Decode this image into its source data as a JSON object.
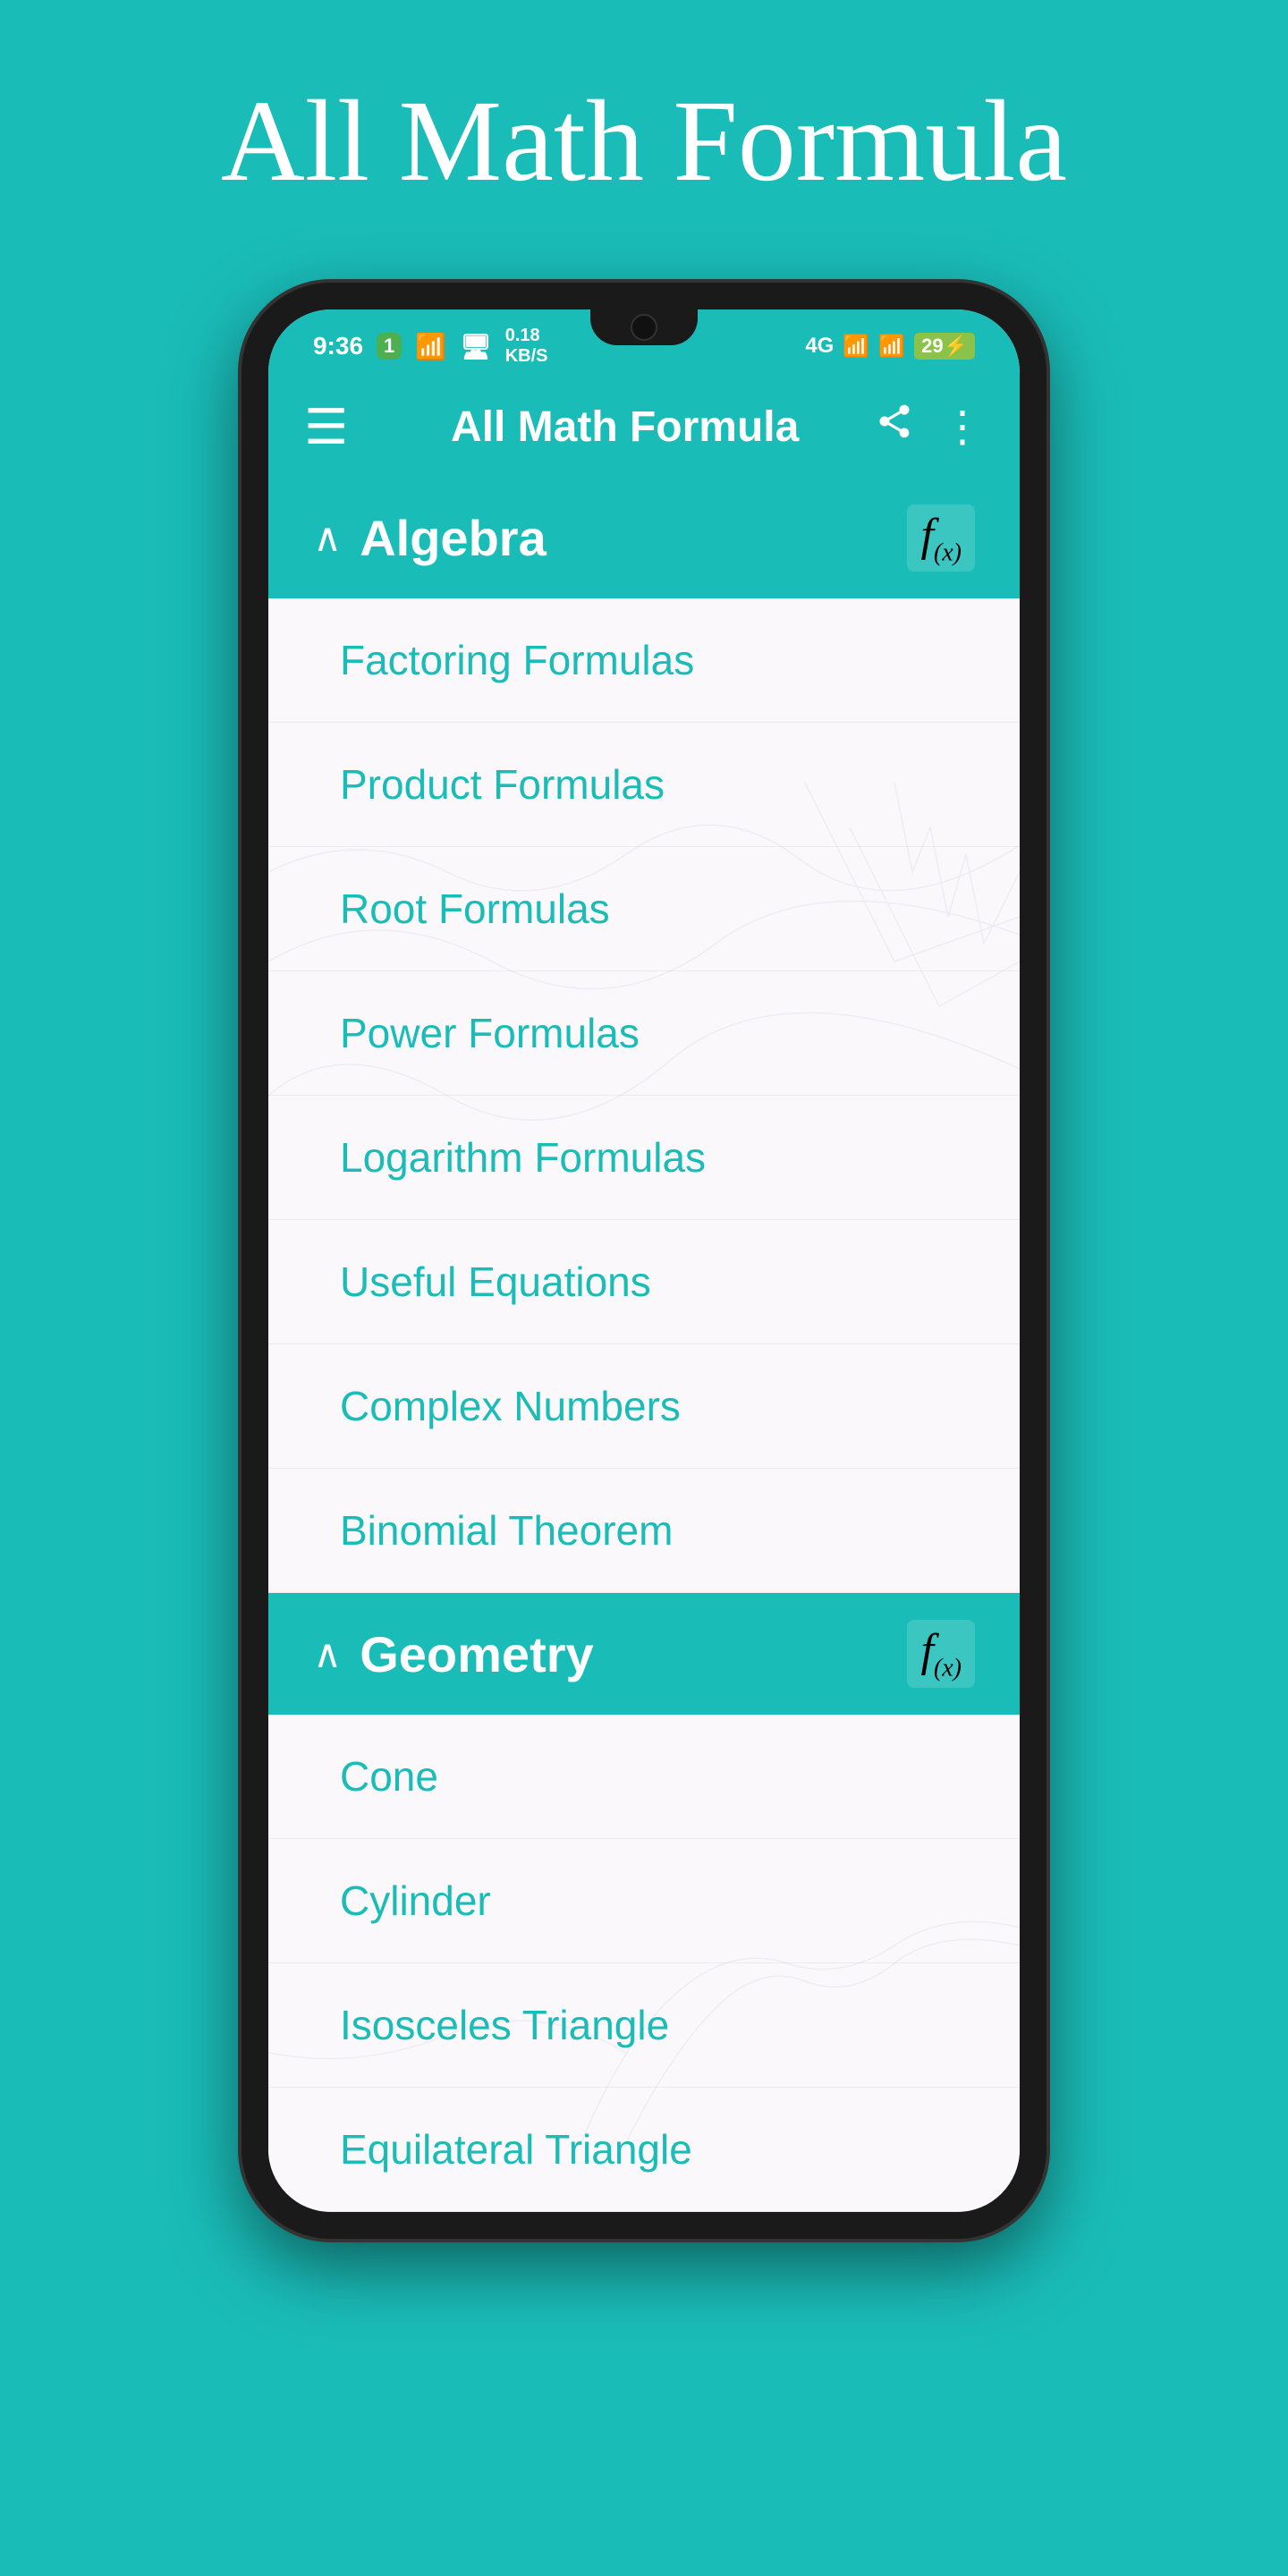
{
  "app": {
    "title": "All Math Formula",
    "header_title": "All Math Formula"
  },
  "status_bar": {
    "time": "9:36",
    "wifi_badge": "1",
    "data_speed": "0.18\nKB/S",
    "network": "4G",
    "battery": "29"
  },
  "toolbar": {
    "title": "All Math Formula",
    "menu_icon": "☰",
    "share_icon": "⎗",
    "more_icon": "⋮"
  },
  "sections": [
    {
      "id": "algebra",
      "title": "Algebra",
      "icon": "f(x)",
      "expanded": true,
      "items": [
        "Factoring Formulas",
        "Product Formulas",
        "Root Formulas",
        "Power Formulas",
        "Logarithm Formulas",
        "Useful Equations",
        "Complex Numbers",
        "Binomial Theorem"
      ]
    },
    {
      "id": "geometry",
      "title": "Geometry",
      "icon": "f(x)",
      "expanded": true,
      "items": [
        "Cone",
        "Cylinder",
        "Isosceles Triangle",
        "Equilateral Triangle"
      ]
    }
  ]
}
